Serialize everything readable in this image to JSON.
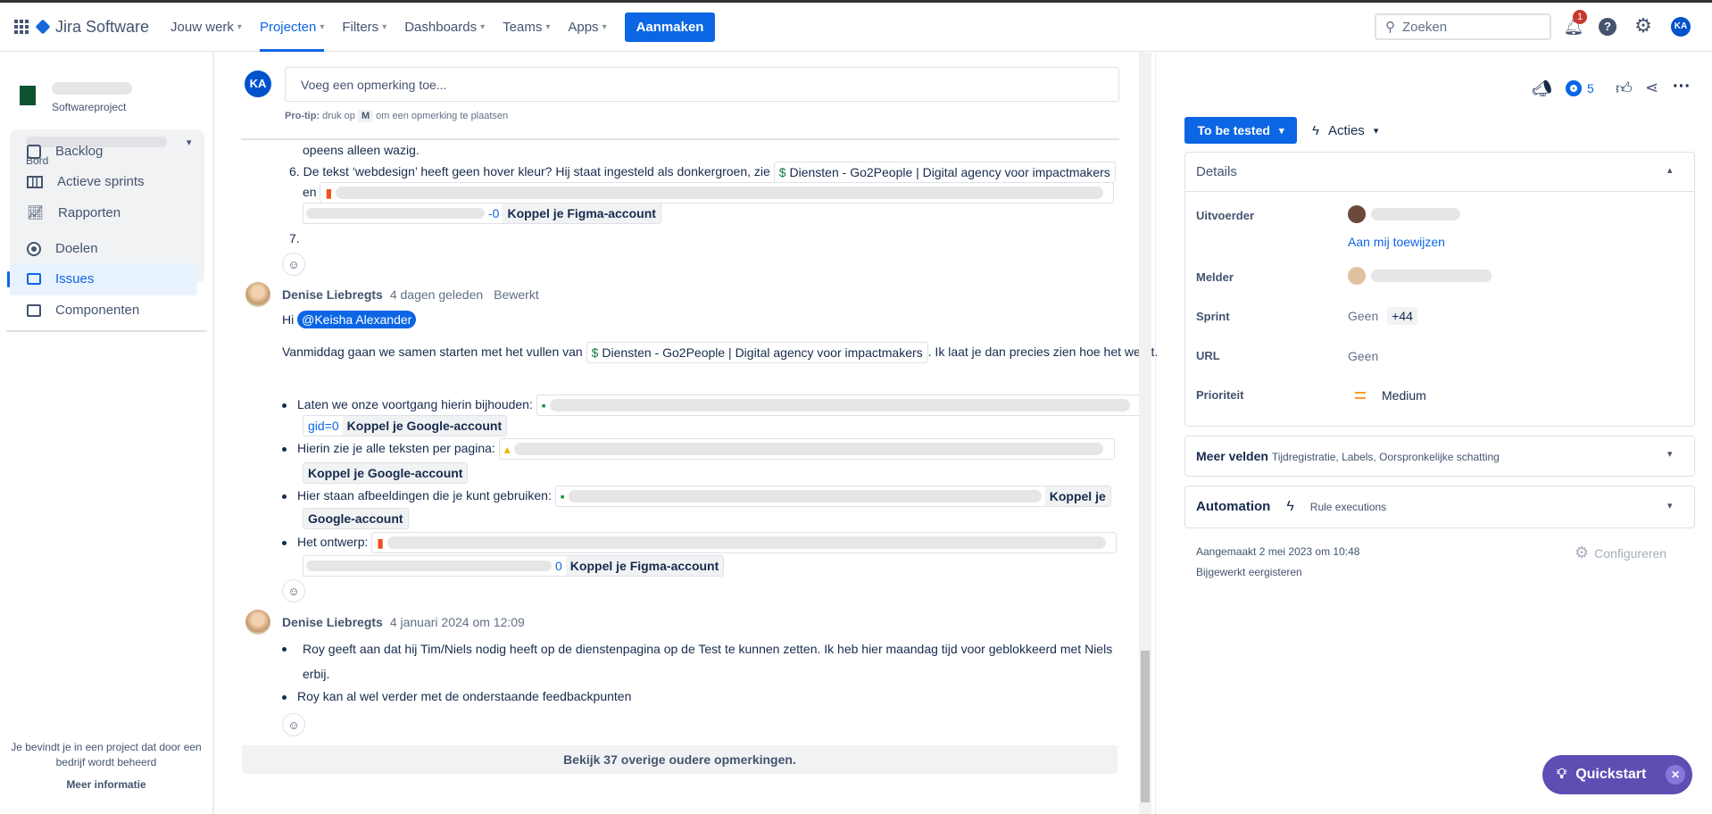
{
  "nav": {
    "app_name": "Jira Software",
    "items": [
      "Jouw werk",
      "Projecten",
      "Filters",
      "Dashboards",
      "Teams",
      "Apps"
    ],
    "create_label": "Aanmaken",
    "search_placeholder": "Zoeken",
    "notification_count": "1",
    "user_initials": "KA",
    "accent": "#0c66e4"
  },
  "sidebar": {
    "project_type": "Softwareproject",
    "group_label": "Bord",
    "group_items": [
      "Backlog",
      "Actieve sprints",
      "Rapporten"
    ],
    "items": [
      "Doelen",
      "Issues",
      "Componenten"
    ],
    "active": "Issues",
    "footer_text": "Je bevindt je in een project dat door een bedrijf wordt beheerd",
    "footer_link": "Meer informatie"
  },
  "comment_box": {
    "avatar": "KA",
    "placeholder": "Voeg een opmerking toe...",
    "protip_bold": "Pro-tip:",
    "protip_pre": "druk op",
    "protip_key": "M",
    "protip_post": "om een opmerking te plaatsen"
  },
  "comments": [
    {
      "continuation": "opeens alleen wazig.",
      "item6_num": "6.",
      "item6_text": "De tekst ‘webdesign’ heeft geen hover kleur? Hij staat ingesteld als donkergroen, zie",
      "item6_chip": "Diensten - Go2People | Digital agency voor impactmakers",
      "item6_en": "en",
      "item6_link_tail": "-0",
      "item6_koppel": "Koppel je Figma-account",
      "item7_num": "7."
    },
    {
      "author": "Denise Liebregts",
      "time": "4 dagen geleden",
      "edited": "Bewerkt",
      "hi": "Hi",
      "mention": "@Keisha Alexander",
      "para_pre": "Vanmiddag gaan we samen starten met het vullen van",
      "para_chip": "Diensten - Go2People | Digital agency voor impactmakers",
      "para_post": ". Ik laat je dan precies zien hoe het werkt.",
      "bullets": [
        {
          "text": "Laten we onze voortgang hierin bijhouden:",
          "link_tail": "gid=0",
          "koppel": "Koppel je Google-account"
        },
        {
          "text": "Hierin zie je alle teksten per pagina:",
          "koppel": "Koppel je Google-account"
        },
        {
          "text": "Hier staan afbeeldingen die je kunt gebruiken:",
          "koppel_a": "Koppel je",
          "koppel_b": "Google-account"
        },
        {
          "text": "Het ontwerp:",
          "link_tail": "0",
          "koppel": "Koppel je Figma-account"
        }
      ]
    },
    {
      "author": "Denise Liebregts",
      "time": "4 januari 2024 om 12:09",
      "bullets": [
        "Roy geeft aan dat hij Tim/Niels nodig heeft op de dienstenpagina op de Test te kunnen zetten. Ik heb hier maandag tijd voor geblokkeerd met Niels erbij.",
        "Roy kan al wel verder met de onderstaande feedbackpunten"
      ]
    }
  ],
  "older_comments": "Bekijk 37 overige oudere opmerkingen.",
  "issue_panel": {
    "watchers": "5",
    "status": "To be tested",
    "actions": "Acties",
    "details_title": "Details",
    "fields": {
      "assignee_label": "Uitvoerder",
      "assign_me": "Aan mij toewijzen",
      "reporter_label": "Melder",
      "sprint_label": "Sprint",
      "sprint_value": "Geen",
      "sprint_more": "+44",
      "url_label": "URL",
      "url_value": "Geen",
      "priority_label": "Prioriteit",
      "priority_value": "Medium",
      "priority_color": "#ff991f"
    },
    "more_fields_title": "Meer velden",
    "more_fields_list": "Tijdregistratie, Labels, Oorspronkelijke schatting",
    "automation_title": "Automation",
    "automation_sub": "Rule executions",
    "created": "Aangemaakt 2 mei 2023 om 10:48",
    "updated": "Bijgewerkt eergisteren",
    "configure": "Configureren"
  },
  "quickstart": "Quickstart"
}
